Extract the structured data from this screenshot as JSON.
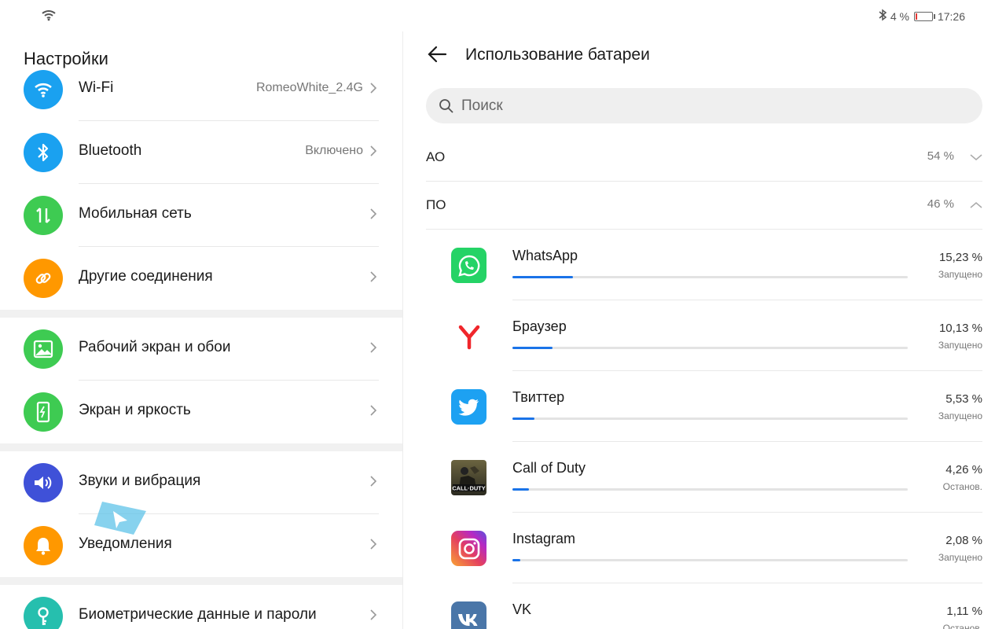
{
  "status": {
    "battery": "4 %",
    "time": "17:26"
  },
  "settings": {
    "title": "Настройки",
    "items": [
      {
        "label": "Wi-Fi",
        "value": "RomeoWhite_2.4G",
        "icon": "wifi-icon",
        "color": "#1aa1f0"
      },
      {
        "label": "Bluetooth",
        "value": "Включено",
        "icon": "bluetooth-icon",
        "color": "#1aa1f0"
      },
      {
        "label": "Мобильная сеть",
        "value": "",
        "icon": "mobile-data-icon",
        "color": "#3ecb52"
      },
      {
        "label": "Другие соединения",
        "value": "",
        "icon": "link-icon",
        "color": "#ff9800"
      },
      {
        "label": "Рабочий экран и обои",
        "value": "",
        "icon": "image-icon",
        "color": "#3ecb52"
      },
      {
        "label": "Экран и яркость",
        "value": "",
        "icon": "phone-brightness-icon",
        "color": "#3ecb52"
      },
      {
        "label": "Звуки и вибрация",
        "value": "",
        "icon": "speaker-icon",
        "color": "#3f51d8"
      },
      {
        "label": "Уведомления",
        "value": "",
        "icon": "bell-icon",
        "color": "#ff9800"
      },
      {
        "label": "Биометрические данные и пароли",
        "value": "",
        "icon": "key-icon",
        "color": "#26bfae"
      }
    ]
  },
  "battery_usage": {
    "title": "Использование батареи",
    "search_placeholder": "Поиск",
    "groups": [
      {
        "label": "АО",
        "value": "54 %",
        "expanded": false
      },
      {
        "label": "ПО",
        "value": "46 %",
        "expanded": true
      }
    ],
    "apps": [
      {
        "name": "WhatsApp",
        "percent": "15,23 %",
        "fraction": 0.1523,
        "status": "Запущено",
        "icon": "whatsapp-icon"
      },
      {
        "name": "Браузер",
        "percent": "10,13 %",
        "fraction": 0.1013,
        "status": "Запущено",
        "icon": "yandex-browser-icon"
      },
      {
        "name": "Твиттер",
        "percent": "5,53 %",
        "fraction": 0.0553,
        "status": "Запущено",
        "icon": "twitter-icon"
      },
      {
        "name": "Call of Duty",
        "percent": "4,26 %",
        "fraction": 0.0426,
        "status": "Останов.",
        "icon": "call-of-duty-icon"
      },
      {
        "name": "Instagram",
        "percent": "2,08 %",
        "fraction": 0.0208,
        "status": "Запущено",
        "icon": "instagram-icon"
      },
      {
        "name": "VK",
        "percent": "1,11 %",
        "fraction": 0.0111,
        "status": "Останов.",
        "icon": "vk-icon"
      }
    ]
  }
}
